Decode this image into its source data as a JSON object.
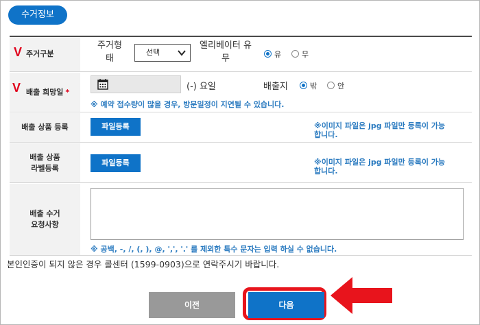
{
  "section_title": "수거정보",
  "rows": {
    "pickup_type": {
      "label": "주거구분",
      "housing_form_label_line1": "주거형",
      "housing_form_label_line2": "태",
      "select_value": "선택",
      "elevator_label_line1": "엘리베이터 유",
      "elevator_label_line2": "무",
      "radio_yes": "유",
      "radio_no": "무",
      "selected": "유"
    },
    "date": {
      "label": "배출 희망일",
      "required_mark": "*",
      "weekday_text": "(-) 요일",
      "location_label": "배출지",
      "radio_out": "밖",
      "radio_in": "안",
      "selected": "밖",
      "note": "※ 예약 접수량이 많을 경우, 방문일정이 지연될 수 있습니다."
    },
    "product_register": {
      "label": "배출 상품 등록",
      "button": "파일등록",
      "note_line1": "※이미지 파일은 jpg 파일만 등록이 가능",
      "note_line2": "합니다."
    },
    "label_register": {
      "label_line1": "배출 상품",
      "label_line2": "라벨등록",
      "button": "파일등록",
      "note_line1": "※이미지 파일은 jpg 파일만 등록이 가능",
      "note_line2": "합니다."
    },
    "request": {
      "label_line1": "배출 수거",
      "label_line2": "요청사항",
      "value": "",
      "note": "※ 공백, -, /, (, ), @, ',', '.' 를 제외한 특수 문자는 입력 하실 수 없습니다."
    }
  },
  "footer_note": "본인인증이 되지 않은 경우 콜센터 (1599-0903)으로 연락주시기 바랍니다.",
  "buttons": {
    "prev": "이전",
    "next": "다음"
  },
  "icons": {
    "required_marker": "v-mark",
    "calendar": "calendar-icon",
    "dropdown": "chevron-down-icon",
    "annotation_arrow": "red-arrow"
  },
  "colors": {
    "primary": "#0f73c8",
    "annotation": "#e8141c",
    "note": "#2b7bc0",
    "prev_button": "#999999"
  }
}
